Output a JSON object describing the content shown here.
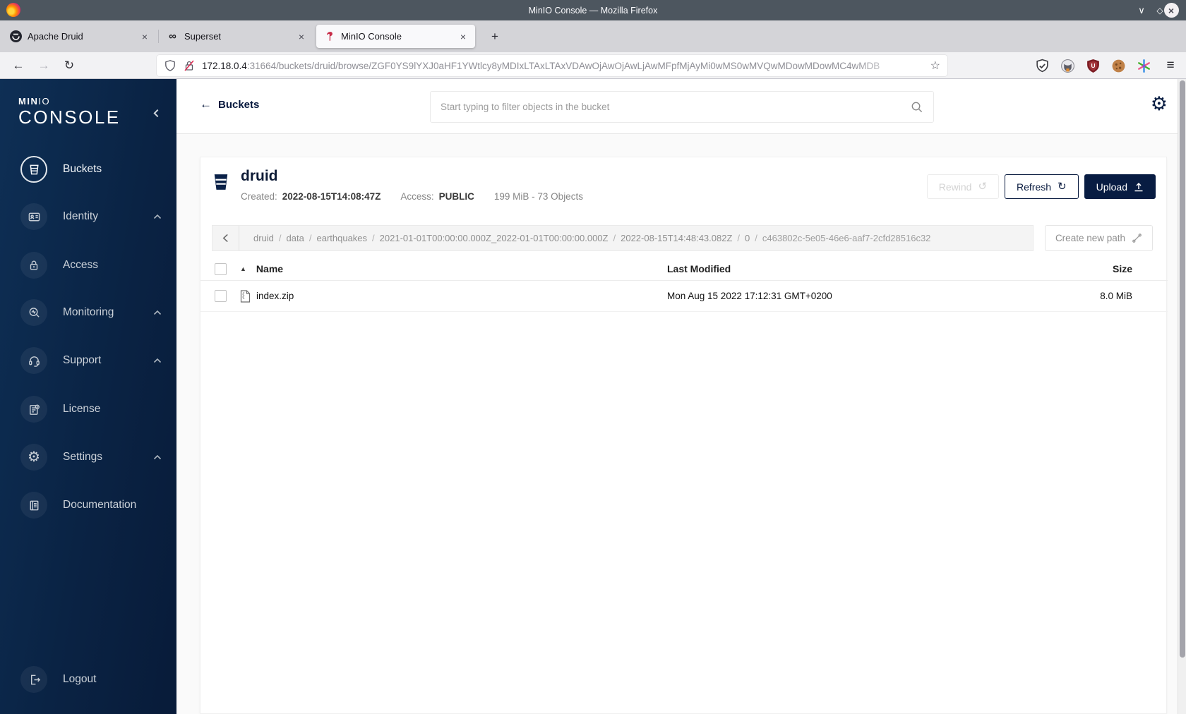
{
  "window": {
    "title": "MinIO Console — Mozilla Firefox"
  },
  "browser": {
    "tabs": [
      {
        "label": "Apache Druid"
      },
      {
        "label": "Superset"
      },
      {
        "label": "MinIO Console"
      }
    ],
    "url_host": "172.18.0.4",
    "url_rest": ":31664/buckets/druid/browse/ZGF0YS9lYXJ0aHF1YWtlcy8yMDIxLTAxLTAxVDAwOjAwOjAwLjAwMFpfMjAyMi0wMS0wMVQwMDowMDowMC4wMDB"
  },
  "glyphs": {
    "close": "×",
    "minimize": "∨",
    "maximize": "◇",
    "new_tab": "+",
    "back": "←",
    "forward": "→",
    "reload": "↻",
    "star": "☆",
    "menu": "≡",
    "infinity": "∞",
    "gear": "⚙",
    "refresh": "↻",
    "rewind": "↺",
    "sort_asc": "▲"
  },
  "sidebar": {
    "logo_bold": "MIN",
    "logo_thin": "IO",
    "logo_main": "CONSOLE",
    "items": [
      {
        "label": "Buckets"
      },
      {
        "label": "Identity"
      },
      {
        "label": "Access"
      },
      {
        "label": "Monitoring"
      },
      {
        "label": "Support"
      },
      {
        "label": "License"
      },
      {
        "label": "Settings"
      },
      {
        "label": "Documentation"
      }
    ],
    "logout_label": "Logout"
  },
  "console_header": {
    "back_label": "Buckets",
    "search_placeholder": "Start typing to filter objects in the bucket"
  },
  "bucket": {
    "name": "druid",
    "created_label": "Created:",
    "created_value": "2022-08-15T14:08:47Z",
    "access_label": "Access:",
    "access_value": "PUBLIC",
    "summary": "199 MiB - 73 Objects",
    "rewind_label": "Rewind",
    "refresh_label": "Refresh",
    "upload_label": "Upload"
  },
  "path_bar": {
    "segments": [
      "druid",
      "data",
      "earthquakes",
      "2021-01-01T00:00:00.000Z_2022-01-01T00:00:00.000Z",
      "2022-08-15T14:48:43.082Z",
      "0",
      "c463802c-5e05-46e6-aaf7-2cfd28516c32"
    ],
    "create_path_label": "Create new path"
  },
  "table": {
    "headers": {
      "name": "Name",
      "modified": "Last Modified",
      "size": "Size"
    },
    "rows": [
      {
        "name": "index.zip",
        "modified": "Mon Aug 15 2022 17:12:31 GMT+0200",
        "size": "8.0 MiB"
      }
    ]
  },
  "colors": {
    "navy": "#081C42",
    "minio_red": "#C72C48",
    "sidebar_top": "#0e2f55",
    "sidebar_bottom": "#081b39"
  }
}
